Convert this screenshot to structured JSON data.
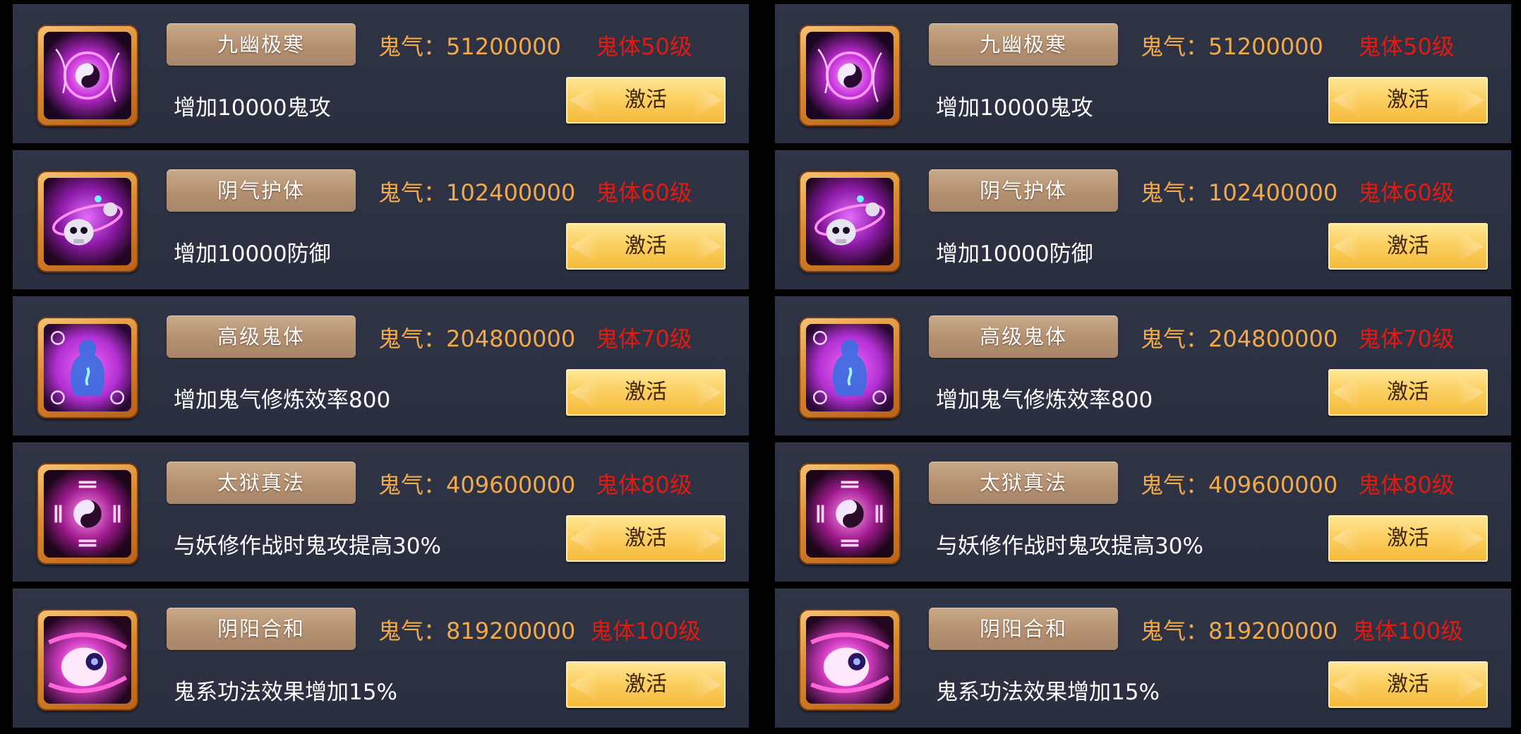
{
  "panels": [
    {
      "cards": [
        {
          "icon": "yinyang-vortex-icon",
          "title": "九幽极寒",
          "cost_label": "鬼气：",
          "cost_value": "51200000",
          "level": "鬼体50级",
          "desc": "增加10000鬼攻",
          "button": "激活"
        },
        {
          "icon": "skull-orbit-icon",
          "title": "阴气护体",
          "cost_label": "鬼气：",
          "cost_value": "102400000",
          "level": "鬼体60级",
          "desc": "增加10000防御",
          "button": "激活"
        },
        {
          "icon": "ghost-body-icon",
          "title": "高级鬼体",
          "cost_label": "鬼气：",
          "cost_value": "204800000",
          "level": "鬼体70级",
          "desc": "增加鬼气修炼效率800",
          "button": "激活"
        },
        {
          "icon": "bagua-yinyang-icon",
          "title": "太狱真法",
          "cost_label": "鬼气：",
          "cost_value": "409600000",
          "level": "鬼体80级",
          "desc": "与妖修作战时鬼攻提高30%",
          "button": "激活"
        },
        {
          "icon": "yin-yang-orb-icon",
          "title": "阴阳合和",
          "cost_label": "鬼气：",
          "cost_value": "819200000",
          "level": "鬼体100级",
          "desc": "鬼系功法效果增加15%",
          "button": "激活"
        }
      ]
    },
    {
      "cards": [
        {
          "icon": "yinyang-vortex-icon",
          "title": "九幽极寒",
          "cost_label": "鬼气：",
          "cost_value": "51200000",
          "level": "鬼体50级",
          "desc": "增加10000鬼攻",
          "button": "激活"
        },
        {
          "icon": "skull-orbit-icon",
          "title": "阴气护体",
          "cost_label": "鬼气：",
          "cost_value": "102400000",
          "level": "鬼体60级",
          "desc": "增加10000防御",
          "button": "激活"
        },
        {
          "icon": "ghost-body-icon",
          "title": "高级鬼体",
          "cost_label": "鬼气：",
          "cost_value": "204800000",
          "level": "鬼体70级",
          "desc": "增加鬼气修炼效率800",
          "button": "激活"
        },
        {
          "icon": "bagua-yinyang-icon",
          "title": "太狱真法",
          "cost_label": "鬼气：",
          "cost_value": "409600000",
          "level": "鬼体80级",
          "desc": "与妖修作战时鬼攻提高30%",
          "button": "激活"
        },
        {
          "icon": "yin-yang-orb-icon",
          "title": "阴阳合和",
          "cost_label": "鬼气：",
          "cost_value": "819200000",
          "level": "鬼体100级",
          "desc": "鬼系功法效果增加15%",
          "button": "激活"
        }
      ]
    }
  ],
  "colors": {
    "background": "#000000",
    "card": "#2e3345",
    "cost_text": "#f1a94a",
    "level_text": "#e01b10",
    "desc_text": "#ffffff",
    "button_gold": "#fcd266"
  }
}
